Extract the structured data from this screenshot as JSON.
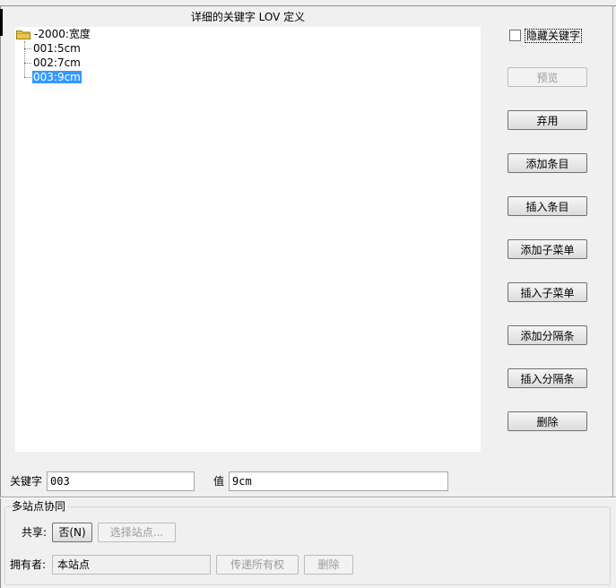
{
  "dialog": {
    "title": "详细的关键字 LOV 定义"
  },
  "tree": {
    "root_label": "-2000:宽度",
    "items": [
      "001:5cm",
      "002:7cm",
      "003:9cm"
    ],
    "selected_index": 2
  },
  "side": {
    "hide_keyword_label": "隐藏关键字",
    "hide_keyword_checked": false,
    "buttons": {
      "preview": "预览",
      "discard": "弃用",
      "add_item": "添加条目",
      "insert_item": "插入条目",
      "add_submenu": "添加子菜单",
      "insert_submenu": "插入子菜单",
      "add_separator": "添加分隔条",
      "insert_separator": "插入分隔条",
      "delete": "删除"
    }
  },
  "keyword_row": {
    "keyword_label": "关键字",
    "keyword_value": "003",
    "value_label": "值",
    "value_value": "9cm"
  },
  "multisite": {
    "group_title": "多站点协同",
    "share_label": "共享:",
    "share_value": "否(N)",
    "select_site_button": "选择站点...",
    "owner_label": "拥有者:",
    "owner_value": "本站点",
    "transfer_button": "传递所有权",
    "delete_button": "删除"
  },
  "colors": {
    "selection": "#3399ff",
    "background": "#f0f0f0",
    "folder": "#e8c84a"
  },
  "icons": [
    "folder-icon"
  ]
}
